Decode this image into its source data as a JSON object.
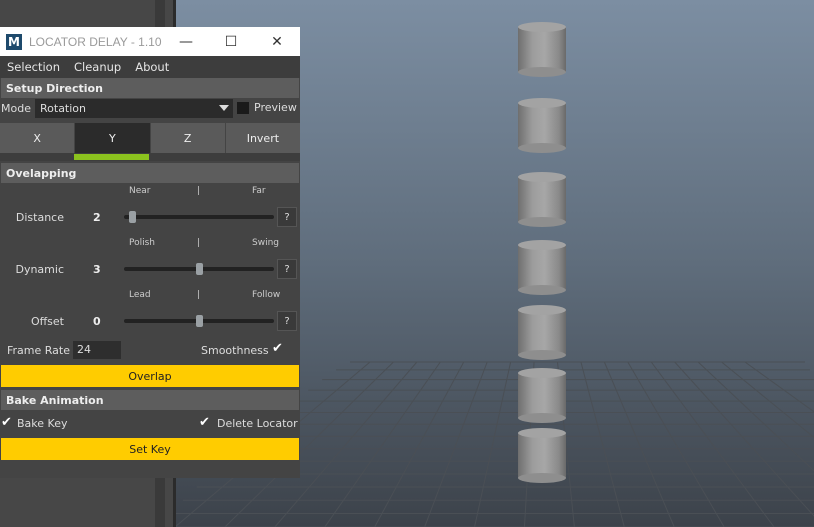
{
  "window": {
    "title": "LOCATOR DELAY - 1.10",
    "icon_letter": "M",
    "controls": {
      "minimize": "—",
      "maximize": "☐",
      "close": "✕"
    }
  },
  "menu": [
    "Selection",
    "Cleanup",
    "About"
  ],
  "setup": {
    "header": "Setup Direction",
    "mode_label": "Mode",
    "mode_value": "Rotation",
    "preview_label": "Preview",
    "preview_checked": false,
    "axes": [
      "X",
      "Y",
      "Z",
      "Invert"
    ],
    "active_axis": "Y"
  },
  "overlapping": {
    "header": "Ovelapping",
    "sliders": [
      {
        "label": "Distance",
        "value": "2",
        "left": "Near",
        "mid": "|",
        "right": "Far",
        "position": 0.05,
        "help": "?"
      },
      {
        "label": "Dynamic",
        "value": "3",
        "left": "Polish",
        "mid": "|",
        "right": "Swing",
        "position": 0.5,
        "help": "?"
      },
      {
        "label": "Offset",
        "value": "0",
        "left": "Lead",
        "mid": "|",
        "right": "Follow",
        "position": 0.5,
        "help": "?"
      }
    ],
    "frame_rate_label": "Frame Rate",
    "frame_rate_value": "24",
    "smoothness_label": "Smoothness",
    "smoothness_checked": true,
    "overlap_button": "Overlap"
  },
  "bake": {
    "header": "Bake Animation",
    "bake_key_label": "Bake Key",
    "bake_key_checked": true,
    "delete_locator_label": "Delete Locator",
    "delete_locator_checked": true,
    "set_key_button": "Set Key"
  },
  "colors": {
    "accent_yellow": "#ffcc00",
    "active_indicator": "#8bc21e",
    "panel": "#444444"
  }
}
